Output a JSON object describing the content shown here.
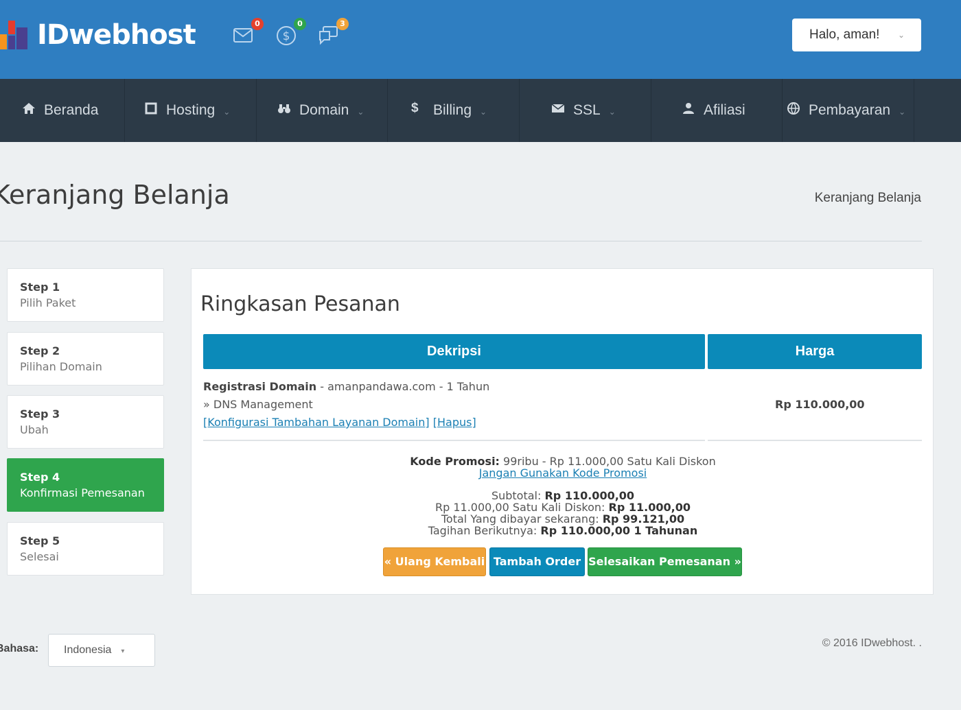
{
  "header": {
    "brand": "IDwebhost",
    "notifications": [
      {
        "icon": "mail-icon",
        "count": "0",
        "badge_color": "#e5412d"
      },
      {
        "icon": "dollar-icon",
        "count": "0",
        "badge_color": "#2fa54d"
      },
      {
        "icon": "chat-icon",
        "count": "3",
        "badge_color": "#f0a33a"
      }
    ],
    "user_menu": "Halo, aman!"
  },
  "nav": {
    "items": [
      {
        "label": "Beranda",
        "icon": "home-icon"
      },
      {
        "label": "Hosting",
        "icon": "server-icon"
      },
      {
        "label": "Domain",
        "icon": "binoculars-icon"
      },
      {
        "label": "Billing",
        "icon": "dollar-icon"
      },
      {
        "label": "SSL",
        "icon": "envelope-icon"
      },
      {
        "label": "Afiliasi",
        "icon": "user-icon"
      },
      {
        "label": "Pembayaran",
        "icon": "globe-icon"
      }
    ]
  },
  "page": {
    "title": "Keranjang Belanja",
    "breadcrumb": "Keranjang Belanja"
  },
  "steps": [
    {
      "title": "Step 1",
      "subtitle": "Pilih Paket"
    },
    {
      "title": "Step 2",
      "subtitle": "Pilihan Domain"
    },
    {
      "title": "Step 3",
      "subtitle": "Ubah"
    },
    {
      "title": "Step 4",
      "subtitle": "Konfirmasi Pemesanan"
    },
    {
      "title": "Step 5",
      "subtitle": "Selesai"
    }
  ],
  "summary": {
    "title": "Ringkasan Pesanan",
    "columns": [
      "Dekripsi",
      "Harga"
    ],
    "item": {
      "name": "Registrasi Domain",
      "detail": " - amanpandawa.com - 1 Tahun",
      "addon": "» DNS Management",
      "config_link": "[Konfigurasi Tambahan Layanan Domain]",
      "delete_link": "[Hapus]",
      "price": "Rp 110.000,00"
    },
    "promo": {
      "label": "Kode Promosi:",
      "value": " 99ribu - Rp 11.000,00 Satu Kali Diskon",
      "remove_link": "Jangan Gunakan Kode Promosi"
    },
    "totals": {
      "subtotal_label": "Subtotal:",
      "subtotal_value": "Rp 110.000,00",
      "discount_label": "Rp 11.000,00 Satu Kali Diskon:",
      "discount_value": "Rp 11.000,00",
      "due_label": "Total Yang dibayar sekarang:",
      "due_value": "Rp 99.121,00",
      "next_label": "Tagihan Berikutnya:",
      "next_value": "Rp 110.000,00 1 Tahunan"
    },
    "buttons": {
      "back": "« Ulang Kembali",
      "add": "Tambah Order",
      "checkout": "Selesaikan Pemesanan  »"
    }
  },
  "footer": {
    "language_label": "Bahasa:",
    "language_value": "Indonesia",
    "copyright": "© 2016 IDwebhost. ."
  }
}
